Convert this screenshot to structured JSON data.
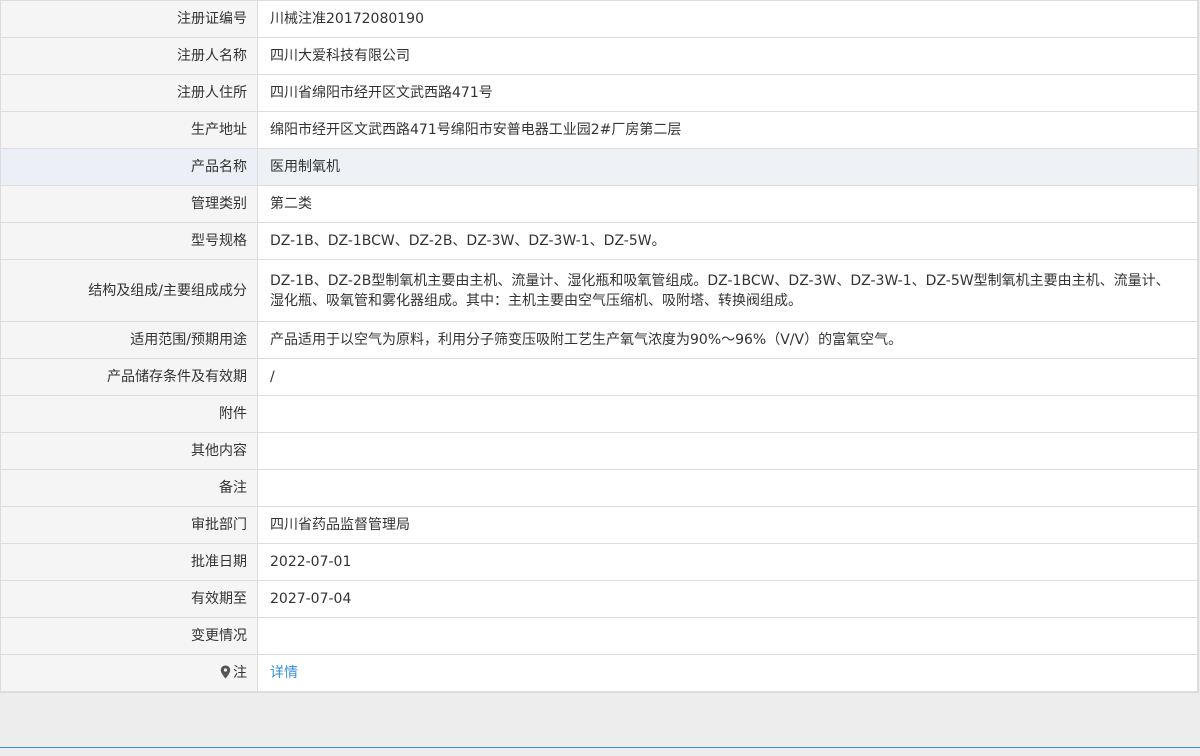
{
  "rows": [
    {
      "label": "注册证编号",
      "value": "川械注准20172080190"
    },
    {
      "label": "注册人名称",
      "value": "四川大爱科技有限公司"
    },
    {
      "label": "注册人住所",
      "value": "四川省绵阳市经开区文武西路471号"
    },
    {
      "label": "生产地址",
      "value": "绵阳市经开区文武西路471号绵阳市安普电器工业园2#厂房第二层"
    },
    {
      "label": "产品名称",
      "value": "医用制氧机"
    },
    {
      "label": "管理类别",
      "value": "第二类"
    },
    {
      "label": "型号规格",
      "value": "DZ-1B、DZ-1BCW、DZ-2B、DZ-3W、DZ-3W-1、DZ-5W。"
    },
    {
      "label": "结构及组成/主要组成成分",
      "value": "DZ-1B、DZ-2B型制氧机主要由主机、流量计、湿化瓶和吸氧管组成。DZ-1BCW、DZ-3W、DZ-3W-1、DZ-5W型制氧机主要由主机、流量计、湿化瓶、吸氧管和雾化器组成。其中：主机主要由空气压缩机、吸附塔、转换阀组成。"
    },
    {
      "label": "适用范围/预期用途",
      "value": "产品适用于以空气为原料，利用分子筛变压吸附工艺生产氧气浓度为90%～96%（V/V）的富氧空气。"
    },
    {
      "label": "产品储存条件及有效期",
      "value": "/"
    },
    {
      "label": "附件",
      "value": ""
    },
    {
      "label": "其他内容",
      "value": ""
    },
    {
      "label": "备注",
      "value": ""
    },
    {
      "label": "审批部门",
      "value": "四川省药品监督管理局"
    },
    {
      "label": "批准日期",
      "value": "2022-07-01"
    },
    {
      "label": "有效期至",
      "value": "2027-07-04"
    },
    {
      "label": "变更情况",
      "value": ""
    }
  ],
  "note": {
    "label": "注",
    "link": "详情",
    "icon": "pin-icon"
  },
  "colors": {
    "link": "#3a8ee6",
    "label_bg": "#f5f5f5",
    "highlight_bg": "#eef1f6"
  }
}
